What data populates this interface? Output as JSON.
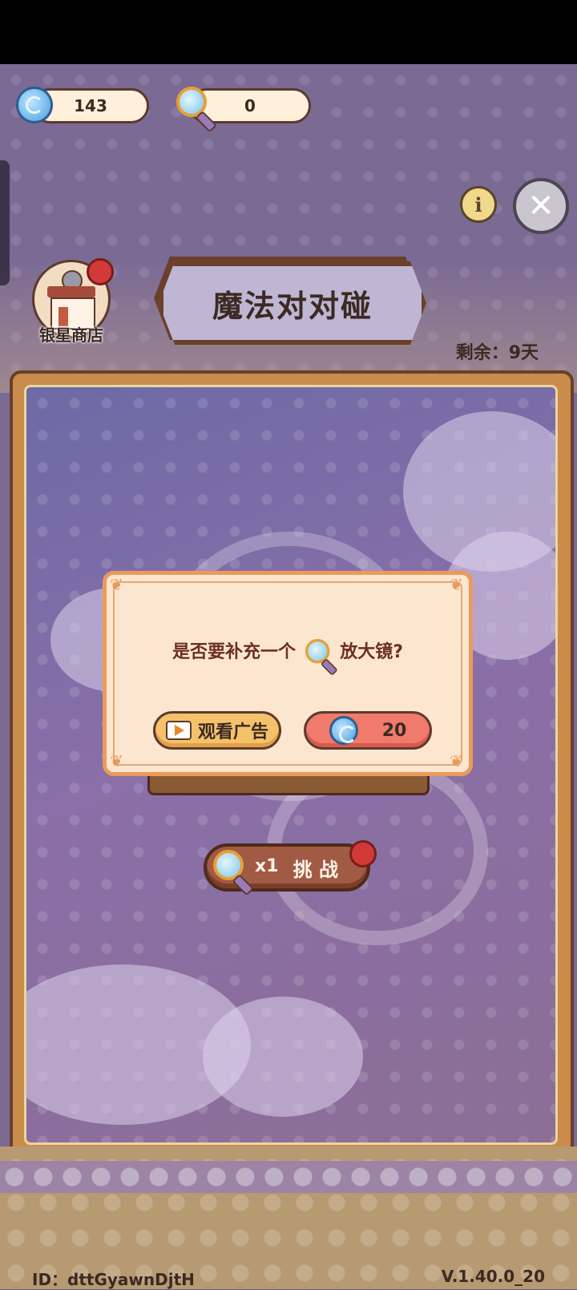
{
  "currency": {
    "gems": "143",
    "magnifiers": "0"
  },
  "shop": {
    "label": "银星商店"
  },
  "title": "魔法对对碰",
  "remaining": "剩余：9天",
  "header_buttons": {
    "info_glyph": "i",
    "close_glyph": "✕"
  },
  "challenge": {
    "count": "x1",
    "label": "挑 战"
  },
  "dialog": {
    "text_before": "是否要补充一个",
    "text_after": "放大镜?",
    "watch_ad_label": "观看广告",
    "gem_cost": "20"
  },
  "footer": {
    "id": "ID：dttGyawnDjtH",
    "version": "V.1.40.0_20"
  },
  "colors": {
    "background": "#7a6a94",
    "dialog": "#fde6cf",
    "accent_red": "#f07a6c",
    "accent_yellow": "#f5c26c"
  }
}
